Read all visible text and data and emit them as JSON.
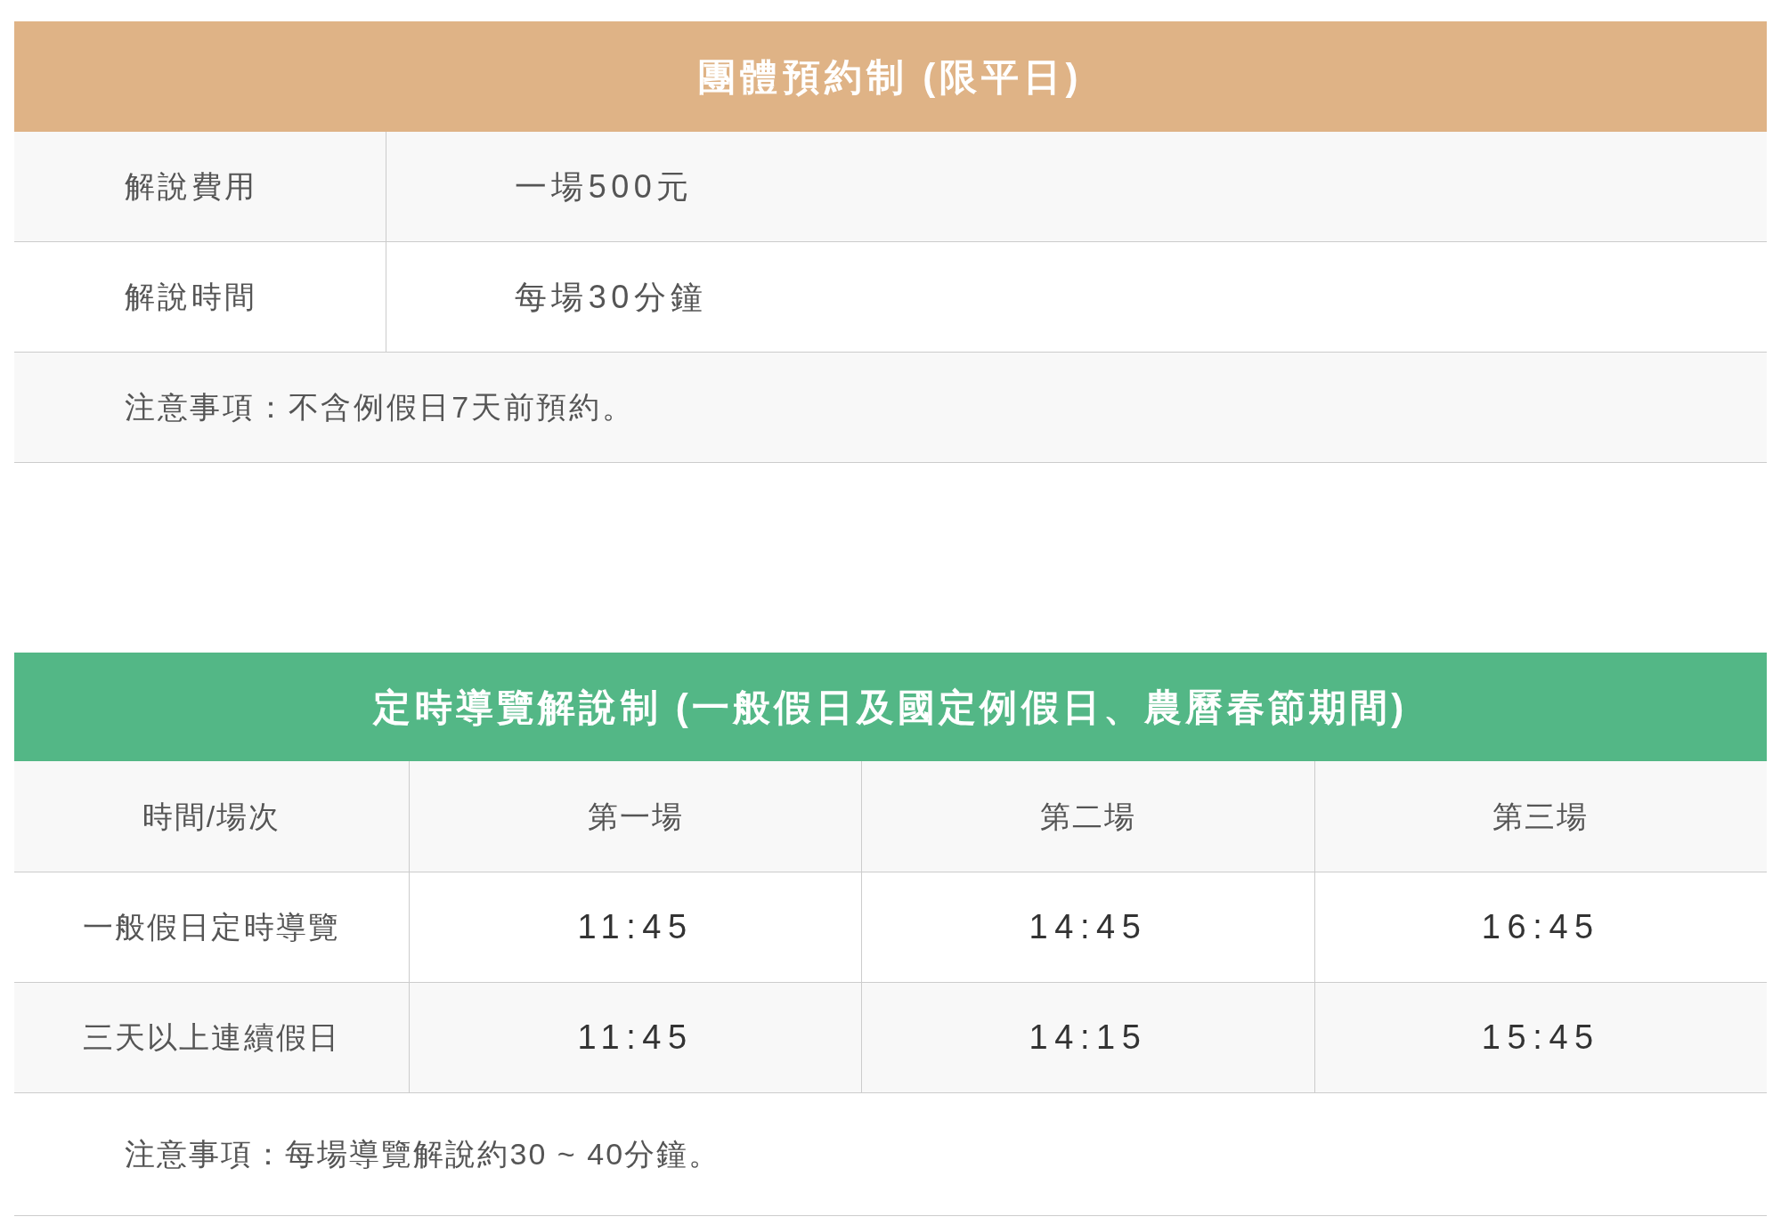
{
  "group_booking": {
    "title": "團體預約制 (限平日)",
    "rows": [
      {
        "label": "解說費用",
        "value": "一場500元"
      },
      {
        "label": "解說時間",
        "value": "每場30分鐘"
      }
    ],
    "note": "注意事項：不含例假日7天前預約。"
  },
  "scheduled_tours": {
    "title": "定時導覽解說制 (一般假日及國定例假日、農曆春節期間)",
    "columns": [
      "時間/場次",
      "第一場",
      "第二場",
      "第三場"
    ],
    "rows": [
      {
        "label": "一般假日定時導覽",
        "times": [
          "11:45",
          "14:45",
          "16:45"
        ]
      },
      {
        "label": "三天以上連續假日",
        "times": [
          "11:45",
          "14:15",
          "15:45"
        ]
      }
    ],
    "note": "注意事項：每場導覽解說約30 ~ 40分鐘。"
  }
}
